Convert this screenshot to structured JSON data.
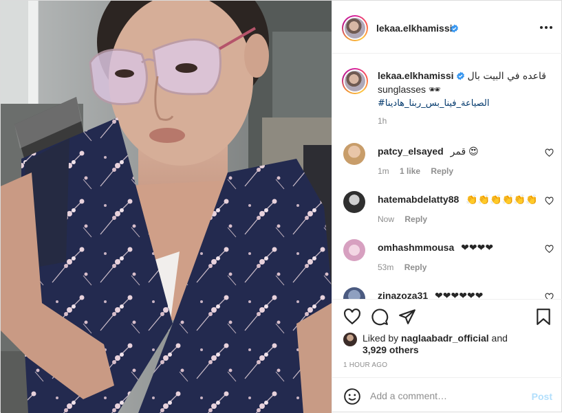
{
  "post": {
    "username": "lekaa.elkhamissi",
    "verified": true,
    "more_icon": "more-horizontal-icon"
  },
  "caption": {
    "username": "lekaa.elkhamissi",
    "text_arabic": "قاعده في البيت بال",
    "text_english": "sunglasses 🕶",
    "hashtag": "#الصياعة_فينا_بس_ربنا_هادينا",
    "time": "1h"
  },
  "comments": [
    {
      "username": "patcy_elsayed",
      "text": "قمر 😍",
      "time": "1m",
      "likes": "1 like",
      "reply": "Reply"
    },
    {
      "username": "hatemabdelatty88",
      "text": "👏👏👏👏👏👏",
      "time": "Now",
      "reply": "Reply"
    },
    {
      "username": "omhashmmousa",
      "text": "❤❤❤❤",
      "time": "53m",
      "reply": "Reply"
    },
    {
      "username": "zinazoza31",
      "text": "❤❤❤❤❤❤",
      "time": "",
      "reply": ""
    }
  ],
  "likes": {
    "prefix": "Liked by",
    "user": "naglaabadr_official",
    "and": "and",
    "count": "3,929 others"
  },
  "posted_time": "1 HOUR AGO",
  "add_comment": {
    "placeholder": "Add a comment…",
    "post_label": "Post"
  },
  "colors": {
    "verified": "#3897f0",
    "link": "#00376b",
    "muted": "#8e8e8e",
    "post_disabled": "#b2dffc",
    "robe": "#232a4f"
  }
}
